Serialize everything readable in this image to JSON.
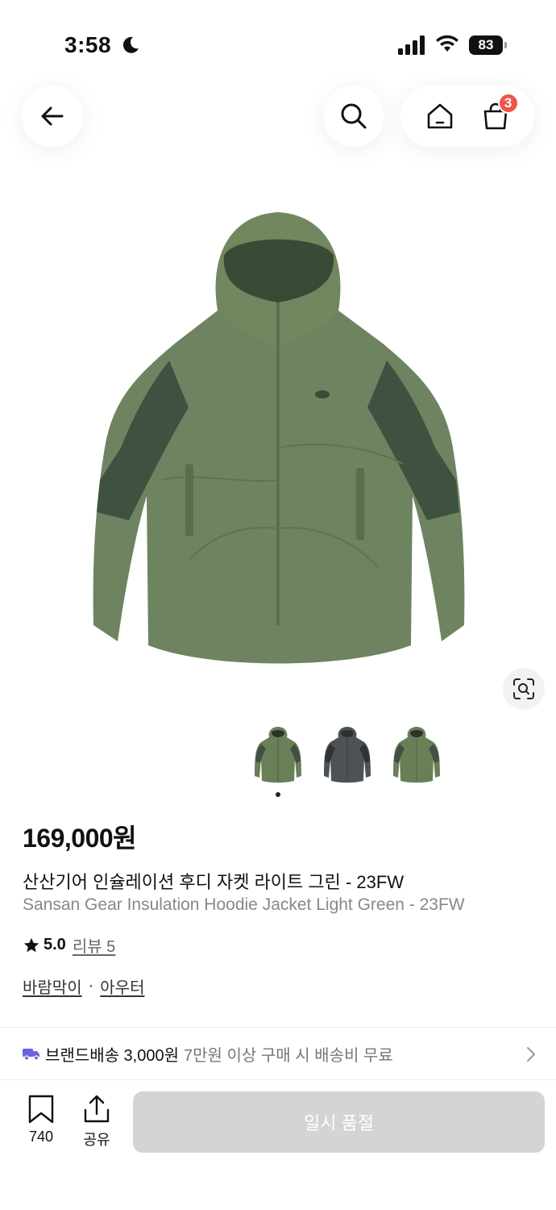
{
  "status_bar": {
    "time": "3:58",
    "battery": "83"
  },
  "nav": {
    "cart_count": "3"
  },
  "product": {
    "price": "169,000원",
    "title_ko": "산산기어 인슐레이션 후디 자켓 라이트 그린 - 23FW",
    "title_en": "Sansan Gear Insulation Hoodie Jacket Light Green - 23FW",
    "rating": "5.0",
    "review_link": "리뷰 5",
    "categories": [
      "바람막이",
      "아우터"
    ],
    "category_separator": "·",
    "thumbnail_colors": [
      "#6a7f58",
      "#4d5256",
      "#6a7f58"
    ],
    "body_color": "#6e8460",
    "panel_color": "#3f5242"
  },
  "shipping": {
    "label": "브랜드배송 3,000원",
    "note": "7만원 이상 구매 시 배송비 무료"
  },
  "bottom": {
    "wishlist_count": "740",
    "share_label": "공유",
    "cta_label": "일시 품절"
  },
  "colors": {
    "accent_badge": "#f0554a",
    "truck": "#6c63e0",
    "disabled_button": "#d4d4d4"
  }
}
